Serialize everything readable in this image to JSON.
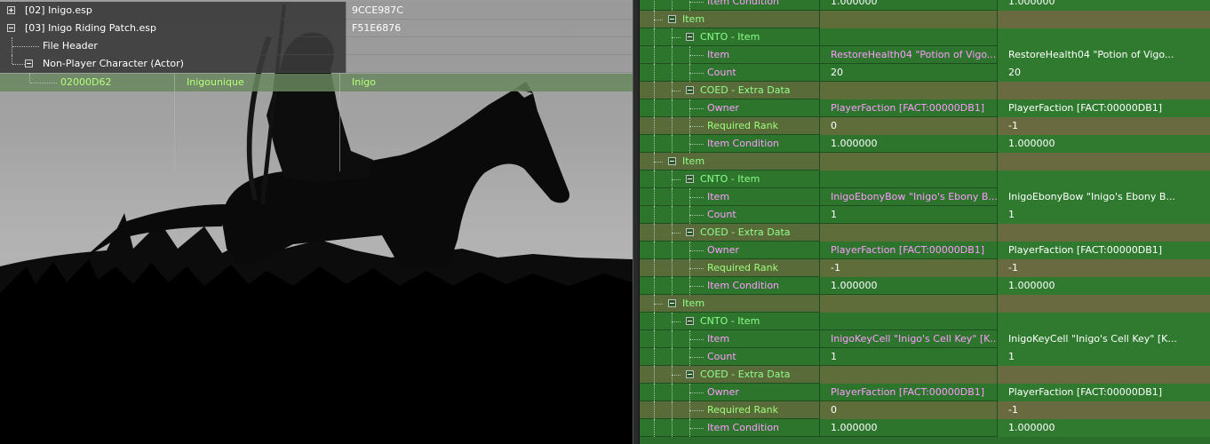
{
  "left_tree": {
    "rows": [
      {
        "label": "[02] Inigo.esp",
        "formid": "9CCE987C",
        "expander": "plus"
      },
      {
        "label": "[03] Inigo Riding Patch.esp",
        "formid": "F51E6876",
        "expander": "minus"
      },
      {
        "label": "File Header"
      },
      {
        "label": "Non-Player Character (Actor)",
        "expander": "minus"
      }
    ],
    "selected": {
      "formid": "02000D62",
      "editor_id": "Inigounique",
      "name": "Inigo"
    }
  },
  "right_tree": {
    "top_partial": {
      "label": "Item Condition",
      "v1": "1.000000",
      "v2": "1.000000"
    },
    "items": [
      {
        "item_label": "Item",
        "cnto_label": "CNTO - Item",
        "item_field": "Item",
        "item_v1": "RestoreHealth04 \"Potion of Vigo...",
        "item_v2": "RestoreHealth04 \"Potion of Vigo...",
        "count_field": "Count",
        "count_v1": "20",
        "count_v2": "20",
        "coed_label": "COED - Extra Data",
        "owner_field": "Owner",
        "owner_v1": "PlayerFaction [FACT:00000DB1]",
        "owner_v2": "PlayerFaction [FACT:00000DB1]",
        "rank_field": "Required Rank",
        "rank_v1": "0",
        "rank_v2": "-1",
        "cond_field": "Item Condition",
        "cond_v1": "1.000000",
        "cond_v2": "1.000000"
      },
      {
        "item_label": "Item",
        "cnto_label": "CNTO - Item",
        "item_field": "Item",
        "item_v1": "InigoEbonyBow \"Inigo's Ebony B...",
        "item_v2": "InigoEbonyBow \"Inigo's Ebony B...",
        "count_field": "Count",
        "count_v1": "1",
        "count_v2": "1",
        "coed_label": "COED - Extra Data",
        "owner_field": "Owner",
        "owner_v1": "PlayerFaction [FACT:00000DB1]",
        "owner_v2": "PlayerFaction [FACT:00000DB1]",
        "rank_field": "Required Rank",
        "rank_v1": "-1",
        "rank_v2": "-1",
        "cond_field": "Item Condition",
        "cond_v1": "1.000000",
        "cond_v2": "1.000000"
      },
      {
        "item_label": "Item",
        "cnto_label": "CNTO - Item",
        "item_field": "Item",
        "item_v1": "InigoKeyCell \"Inigo's Cell Key\" [K...",
        "item_v2": "InigoKeyCell \"Inigo's Cell Key\" [K...",
        "count_field": "Count",
        "count_v1": "1",
        "count_v2": "1",
        "coed_label": "COED - Extra Data",
        "owner_field": "Owner",
        "owner_v1": "PlayerFaction [FACT:00000DB1]",
        "owner_v2": "PlayerFaction [FACT:00000DB1]",
        "rank_field": "Required Rank",
        "rank_v1": "0",
        "rank_v2": "-1",
        "cond_field": "Item Condition",
        "cond_v1": "1.000000",
        "cond_v2": "1.000000"
      }
    ]
  }
}
